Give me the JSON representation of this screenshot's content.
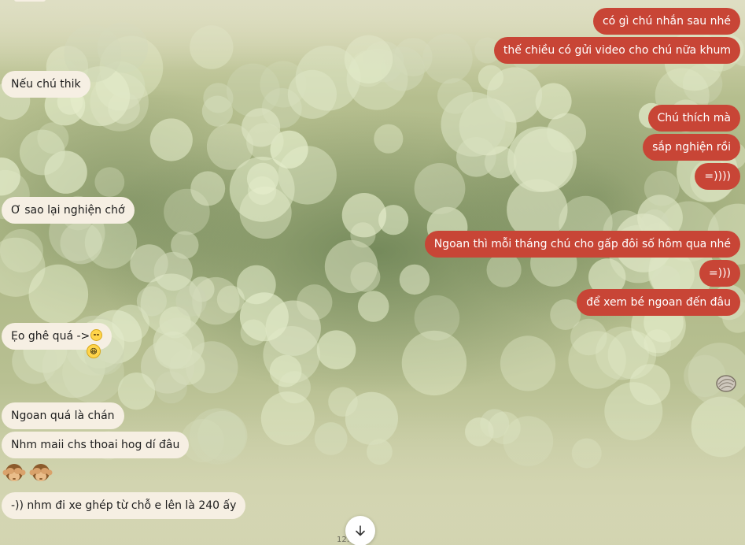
{
  "conversation": {
    "messages": [
      {
        "side": "out",
        "text": "có gì chú nhắn sau nhé"
      },
      {
        "side": "out",
        "text": "thế chiều có gửi video cho chú nữa khum"
      },
      {
        "side": "in",
        "text": "Nếu chú thik"
      },
      {
        "side": "out",
        "text": "Chú thích mà"
      },
      {
        "side": "out",
        "text": "sắp nghiện rồi"
      },
      {
        "side": "out",
        "text": "=))))"
      },
      {
        "side": "in",
        "text": "Ơ sao lại nghiện chớ"
      },
      {
        "side": "out",
        "text": "Ngoan thì mỗi tháng chú cho gấp đôi số hôm qua nhé"
      },
      {
        "side": "out",
        "text": "=)))"
      },
      {
        "side": "out",
        "text": "để xem bé ngoan đến đâu"
      },
      {
        "side": "in",
        "text": "Ẹo ghê quá ->"
      },
      {
        "side": "in",
        "text": "Ngoan quá là chán"
      },
      {
        "side": "in",
        "text": "Nhm maii chs thoai hog dí đâu"
      },
      {
        "side": "in",
        "text": "-)) nhm đi xe ghép từ chỗ e lên là 240 ấy"
      }
    ],
    "reaction_emoji": "😆",
    "monkey_emoji_count": 2,
    "sticker": "oyster-sticker",
    "footer_time_fragment": "12:"
  },
  "colors": {
    "outgoing_bubble": "#c84536",
    "incoming_bubble": "#f6efe3"
  },
  "icons": {
    "scroll_down": "arrow-down-icon",
    "reaction": "laughing-face-icon",
    "inline_emoji": "rolling-eyes-face-icon",
    "monkey": "see-no-evil-monkey-icon"
  }
}
